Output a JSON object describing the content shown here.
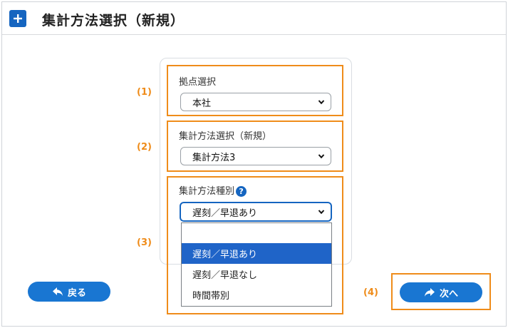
{
  "header": {
    "title": "集計方法選択（新規）",
    "plus_icon": "plus-icon"
  },
  "steps": [
    "(1)",
    "(2)",
    "(3)",
    "(4)"
  ],
  "base": {
    "label": "拠点選択",
    "value": "本社"
  },
  "method": {
    "label": "集計方法選択（新規）",
    "value": "集計方法3"
  },
  "type": {
    "label": "集計方法種別",
    "help": "?",
    "value": "遅刻／早退あり",
    "options": [
      "",
      "遅刻／早退あり",
      "遅刻／早退なし",
      "時間帯別"
    ],
    "selected_index": 1
  },
  "buttons": {
    "back": "戻る",
    "next": "次へ"
  },
  "colors": {
    "accent": "#1976d2",
    "highlight": "#ef8c1a",
    "selected": "#1f64c8"
  }
}
